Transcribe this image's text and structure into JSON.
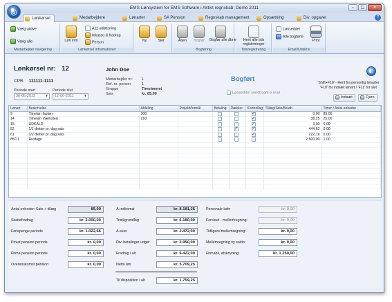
{
  "window": {
    "title": "EMS Lønsystem for EMS Software i Aktivt regnskab: Demo 2011",
    "buttons": {
      "minimize": "–",
      "maximize": "□",
      "close": "✕"
    },
    "orb_glyph": "◎"
  },
  "tabs": [
    {
      "label": "Lønkørsel",
      "active": true
    },
    {
      "label": "Medarbejdere"
    },
    {
      "label": "Lønarter"
    },
    {
      "label": "SA Pension"
    },
    {
      "label": "Regnskab management"
    },
    {
      "label": "Opsætning"
    },
    {
      "label": "Div. opgaver"
    }
  ],
  "help_glyph": "?",
  "ribbon": {
    "nav": {
      "label": "Medarbejder navigering",
      "btn_active": "Vælg aktive",
      "btn_all": "Vælg alle"
    },
    "info": {
      "label": "Lønkørsel informationer",
      "btn_lon_info": "Løn info",
      "btn_a11": "A11 udlæsning",
      "btn_inkasso": "Inkasso & fradrag",
      "btn_person": "Person"
    },
    "new_del": {
      "btn_new": "Ny",
      "btn_del": "Slet"
    },
    "booking": {
      "label": "Bogføring",
      "btn_open": "Åben",
      "btn_book": "Bogfør",
      "btn_book_all": "Bogfør alle åbne"
    },
    "time": {
      "label": "Tidsregistrering",
      "btn_fetch": "Hent alle tids registreringer"
    },
    "email": {
      "label": "Email/Udskriv",
      "btn_payslip": "Lønseddel",
      "btn_all_booked": "Alle bogførte",
      "btn_print": "Print"
    }
  },
  "header": {
    "title_label": "Lønkørsel nr:",
    "run_no": "12",
    "employee_name": "John Doe",
    "cpr_label": "CPR",
    "cpr_value": "111111-1111",
    "period_start_label": "Periode start",
    "period_start": "30-05-2011",
    "period_end_label": "Periode slut",
    "period_end": "12-06-2011",
    "emp_no_label": "Medarbejder nr:",
    "emp_no": "1",
    "ref_person_label": "Ref. nr. person",
    "ref_person": "1",
    "group_label": "Gruppe",
    "group": "Timelønnet",
    "rate_label": "Sats",
    "rate": "kr. 85,00",
    "status": "Bogført",
    "email_payslip_label": "Lønseddel sendt som e-mail",
    "info_text": "'Shift+F10' - Hent fra personlig lønarter\n'F10' for indsæt lønart / 'F11' for slet",
    "btn_insert": "Indsæt",
    "btn_remove": "Fjern",
    "globe_glyph": "◐"
  },
  "grid": {
    "columns": [
      "Lønart",
      "Beskrivelse",
      "Afdeling",
      "Projekt/formål",
      "Betaling",
      "Dækker",
      "Kontrollag",
      "Tillæg/Sats/Beløb",
      "Timer / Antal enheder"
    ],
    "rows": [
      {
        "code": "9",
        "desc": "Timeløn fagløn",
        "dept": "200",
        "proj": "",
        "pay": false,
        "cover": false,
        "ctrl": true,
        "amount": "0,00",
        "units": "85,00"
      },
      {
        "code": "14",
        "desc": "Timeløn Værksted",
        "dept": "210",
        "proj": "",
        "pay": false,
        "cover": false,
        "ctrl": true,
        "amount": "38,25",
        "units": "25,00"
      },
      {
        "code": "15",
        "desc": "UDKALD",
        "dept": "",
        "proj": "",
        "pay": false,
        "cover": false,
        "ctrl": true,
        "amount": "3,00",
        "units": "0,00"
      },
      {
        "code": "52",
        "desc": "1/1 dietter pr. dag sats",
        "dept": "",
        "proj": "",
        "pay": false,
        "cover": true,
        "ctrl": true,
        "amount": "444,62",
        "units": "0,00"
      },
      {
        "code": "61",
        "desc": "1/2 dietter pr. dag sats",
        "dept": "",
        "proj": "",
        "pay": false,
        "cover": false,
        "ctrl": true,
        "amount": "222,16",
        "units": "0,00"
      },
      {
        "code": "850.1",
        "desc": "Hustage",
        "dept": "",
        "proj": "",
        "pay": false,
        "cover": false,
        "ctrl": false,
        "amount": "2.500,00",
        "units": "1,00"
      }
    ]
  },
  "totals": {
    "col1": [
      {
        "label": "Antal enheder: Sats + tillæg",
        "value": "85,00",
        "style": "gray"
      },
      {
        "label": "Skattefradrag",
        "value": "kr. 2.000,00",
        "style": ""
      },
      {
        "label": "Feriepenge periode",
        "value": "kr. 1.022,66",
        "style": ""
      },
      {
        "label": "Privat pension periode",
        "value": "kr. 0,00",
        "style": ""
      },
      {
        "label": "Firma pension periode",
        "value": "kr. 0,00",
        "style": ""
      },
      {
        "label": "Overenskomst pension",
        "value": "kr. 0,00",
        "style": ""
      }
    ],
    "col2": [
      {
        "label": "A-indkomst",
        "value": "kr. 8.181,25",
        "style": "gray"
      },
      {
        "label": "Trækgrundlag",
        "value": "kr. 6.180,00",
        "style": ""
      },
      {
        "label": "A-skat",
        "value": "kr. 2.472,00",
        "style": ""
      },
      {
        "label": "Div. betalinger udgør",
        "value": "kr. 3.950,00",
        "style": ""
      },
      {
        "label": "Fradrag i alt",
        "value": "kr. 6.422,00",
        "style": ""
      },
      {
        "label": "Netto løn",
        "value": "kr. 5.709,25",
        "style": ""
      }
    ],
    "payout": {
      "label": "Til disposition i alt",
      "value": "kr. 1.759,25"
    },
    "col3": [
      {
        "label": "Personale køb:",
        "value": "kr. 0,00",
        "style": "disabled"
      },
      {
        "label": "Forskud - mellemregning:",
        "value": "kr. 0,00",
        "style": "disabled"
      },
      {
        "label": "Tidligere mellemregning:",
        "value": "kr. 0,00",
        "style": ""
      },
      {
        "label": "Mellemregning ny saldo:",
        "value": "kr. 0,00",
        "style": ""
      },
      {
        "label": "Firmabil, afskrivning:",
        "value": "kr. 1.250,00",
        "style": ""
      }
    ]
  },
  "colors": {
    "accent": "#4d82c6",
    "frame": "#d9e4f2"
  }
}
